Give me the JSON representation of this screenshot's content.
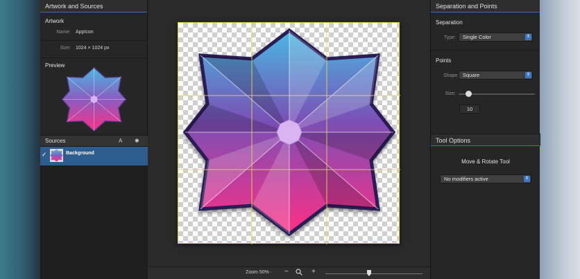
{
  "left_panel": {
    "header": "Artwork and Sources",
    "artwork_title": "Artwork",
    "name_label": "Name:",
    "name_value": "AppIcon",
    "size_label": "Size:",
    "size_value": "1024 × 1024 px",
    "preview_title": "Preview",
    "sources_title": "Sources",
    "sources_a_button": "A",
    "source_item": {
      "checked": "✓",
      "name": "Background"
    }
  },
  "canvas": {
    "zoom_label": "Zoom 50% ·",
    "zoom_minus": "−",
    "zoom_plus": "+",
    "zoom_level": 0.45,
    "colors": {
      "top": "#48b8e0",
      "mid": "#7a4fb5",
      "bottom": "#ff2e84",
      "outline": "#2a1d55",
      "grid": "#e6d85a"
    }
  },
  "right_panel": {
    "header": "Separation and Points",
    "separation_title": "Separation",
    "type_label": "Type:",
    "type_value": "Single Color",
    "points_title": "Points",
    "shape_label": "Shape:",
    "shape_value": "Square",
    "size_label": "Size:",
    "size_value": "10",
    "size_slider_level": 0.13,
    "tool_options_header": "Tool Options",
    "tool_name": "Move & Rotate Tool",
    "modifiers_value": "No modifiers active"
  },
  "icons": [
    "gear-icon",
    "checkmark-icon",
    "magnifier-icon",
    "chevron-updown-icon"
  ]
}
